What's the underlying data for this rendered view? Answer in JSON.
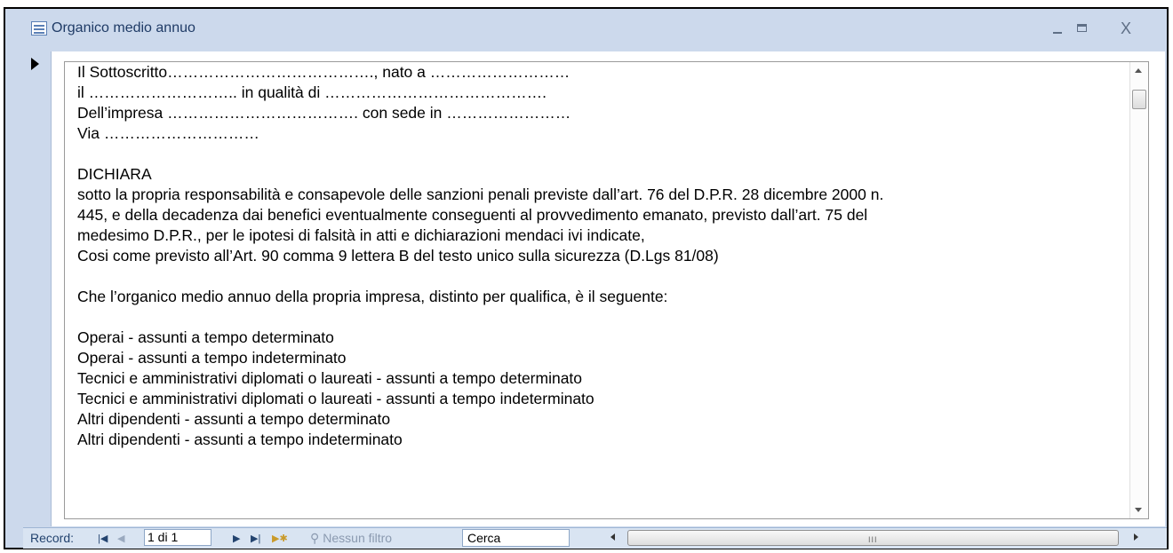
{
  "window": {
    "title": "Organico medio annuo",
    "minimize_label": "_",
    "close_label": "X"
  },
  "memo": {
    "lines": [
      "Il Sottoscritto…………………………………., nato a ………………………",
      "il ……………………….. in qualità di …………………………………….",
      "Dell’impresa ………………………………. con sede in ……………………",
      "Via …………………………",
      "",
      "DICHIARA",
      "sotto la propria responsabilità e consapevole delle sanzioni penali previste dall’art. 76 del D.P.R. 28 dicembre 2000 n.",
      "445, e della decadenza dai benefici eventualmente conseguenti al provvedimento emanato, previsto dall’art. 75 del",
      "medesimo D.P.R., per le ipotesi di falsità in atti e dichiarazioni mendaci ivi indicate,",
      "Cosi come previsto all’Art. 90 comma 9 lettera B del testo unico sulla sicurezza (D.Lgs 81/08)",
      "",
      "Che l’organico medio annuo della propria impresa, distinto per qualifica, è il seguente:",
      "",
      "Operai - assunti a tempo determinato",
      "Operai - assunti a tempo indeterminato",
      "Tecnici e amministrativi diplomati o laureati - assunti a tempo determinato",
      "Tecnici e amministrativi diplomati o laureati - assunti a tempo indeterminato",
      "Altri dipendenti - assunti a tempo determinato",
      "Altri dipendenti - assunti a tempo indeterminato"
    ]
  },
  "statusbar": {
    "record_label": "Record:",
    "first_icon": "first-record-icon",
    "prev_icon": "previous-record-icon",
    "record_value": "1 di 1",
    "next_icon": "next-record-icon",
    "last_icon": "last-record-icon",
    "new_icon": "new-record-icon",
    "filter_label": "Nessun filtro",
    "search_label": "Cerca",
    "hscroll_grip": "III"
  }
}
